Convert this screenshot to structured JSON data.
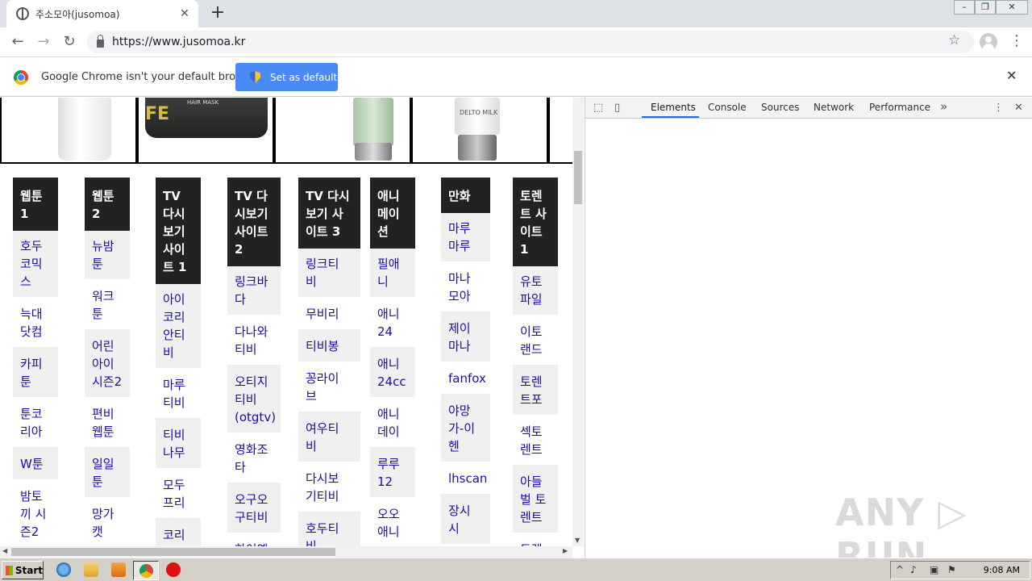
{
  "browser": {
    "tab_title": "주소모아(jusomoa)",
    "tab_close": "✕",
    "new_tab": "+",
    "url": "https://www.jusomoa.kr",
    "back": "←",
    "forward": "→",
    "reload": "↻",
    "star": "☆",
    "menu": "⋮",
    "window_controls": [
      "–",
      "❐",
      "✕"
    ]
  },
  "infobar": {
    "message": "Google Chrome isn't your default browser",
    "button": "Set as default",
    "close": "✕"
  },
  "columns": [
    {
      "header": "웹툰\n1",
      "items": [
        "호두\n코믹\n스",
        "늑대\n닷컴",
        "카피\n툰",
        "툰코\n리아",
        "W툰",
        "밤토\n끼 시\n즌2"
      ]
    },
    {
      "header": "웹툰\n2",
      "items": [
        "뉴밤\n툰",
        "워크\n툰",
        "어린\n아이\n시즌2",
        "편비\n웹툰",
        "일일\n툰",
        "망가\n캣"
      ]
    },
    {
      "header": "TV\n다시\n보기\n사이\n트 1",
      "items": [
        "아이\n코리\n안티\n비",
        "마루\n티비",
        "티비\n나무",
        "모두\n프리",
        "코리"
      ]
    },
    {
      "header": "TV 다\n시보기\n사이트\n2",
      "items": [
        "링크바\n다",
        "다나와\n티비",
        "오티지\n티비\n(otgtv)",
        "영화조\n타",
        "오구오\n구티비",
        "한이옌"
      ]
    },
    {
      "header": "TV 다시\n보기 사\n이트 3",
      "items": [
        "링크티\n비",
        "무비리",
        "티비봉",
        "꽁라이\n브",
        "여우티\n비",
        "다시보\n기티비",
        "호두티\n비"
      ]
    },
    {
      "header": "애니\n메이\n션",
      "items": [
        "필애\n니",
        "애니\n24",
        "애니\n24cc",
        "애니\n데이",
        "루루\n12",
        "오오\n애니"
      ]
    },
    {
      "header": "만화",
      "items": [
        "마루\n마루",
        "마나\n모아",
        "제이\n마나",
        "fanfox",
        "야망\n가-이\n헨",
        "lhscan",
        "장시\n시"
      ]
    },
    {
      "header": "토렌\n트 사\n이트\n1",
      "items": [
        "유토\n파일",
        "이토\n랜드",
        "토렌\n트포",
        "섹토\n렌트",
        "아들\n벌 토\n렌트",
        "토렌"
      ]
    }
  ],
  "devtools": {
    "tabs": [
      "Elements",
      "Console",
      "Sources",
      "Network",
      "Performance"
    ],
    "more": "»",
    "menu": "⋮",
    "close": "✕",
    "inspect": "⬚",
    "device": "▯"
  },
  "taskbar": {
    "start": "Start",
    "clock": "9:08 AM"
  },
  "watermark": "ANY ▷ RUN",
  "banner_labels": [
    "HAIR MASK",
    "FE",
    "DELTO MILK"
  ]
}
